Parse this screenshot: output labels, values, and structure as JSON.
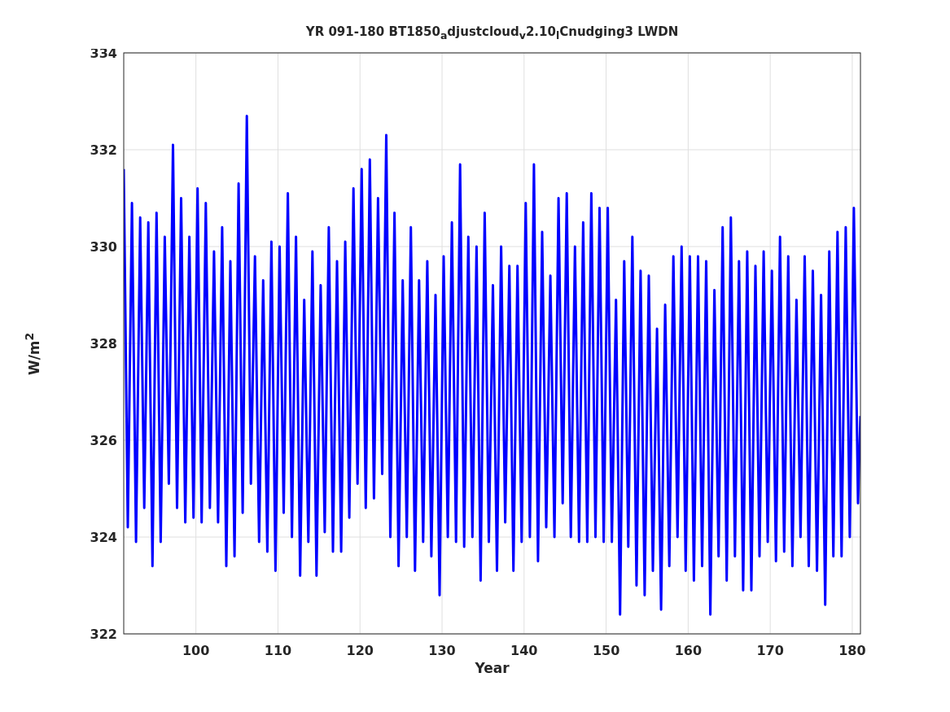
{
  "figure": {
    "chart_data": {
      "type": "line",
      "title": "YR 091-180 BT1850$_{a}$djustcloud$_{v}$2.10$_{l}$Cnudging3 LWDN",
      "xlabel": "Year",
      "ylabel": "W/m$^{2}$",
      "xlim": [
        91.2,
        181
      ],
      "ylim": [
        322,
        334
      ],
      "xticks": [
        100,
        110,
        120,
        130,
        140,
        150,
        160,
        170,
        180
      ],
      "yticks": [
        322,
        324,
        326,
        328,
        330,
        332,
        334
      ],
      "grid": true,
      "x": [
        91.2,
        91.7,
        92.2,
        92.7,
        93.2,
        93.7,
        94.2,
        94.7,
        95.2,
        95.7,
        96.2,
        96.7,
        97.2,
        97.7,
        98.2,
        98.7,
        99.2,
        99.7,
        100.2,
        100.7,
        101.2,
        101.7,
        102.2,
        102.7,
        103.2,
        103.7,
        104.2,
        104.7,
        105.2,
        105.7,
        106.2,
        106.7,
        107.2,
        107.7,
        108.2,
        108.7,
        109.2,
        109.7,
        110.2,
        110.7,
        111.2,
        111.7,
        112.2,
        112.7,
        113.2,
        113.7,
        114.2,
        114.7,
        115.2,
        115.7,
        116.2,
        116.7,
        117.2,
        117.7,
        118.2,
        118.7,
        119.2,
        119.7,
        120.2,
        120.7,
        121.2,
        121.7,
        122.2,
        122.7,
        123.2,
        123.7,
        124.2,
        124.7,
        125.2,
        125.7,
        126.2,
        126.7,
        127.2,
        127.7,
        128.2,
        128.7,
        129.2,
        129.7,
        130.2,
        130.7,
        131.2,
        131.7,
        132.2,
        132.7,
        133.2,
        133.7,
        134.2,
        134.7,
        135.2,
        135.7,
        136.2,
        136.7,
        137.2,
        137.7,
        138.2,
        138.7,
        139.2,
        139.7,
        140.2,
        140.7,
        141.2,
        141.7,
        142.2,
        142.7,
        143.2,
        143.7,
        144.2,
        144.7,
        145.2,
        145.7,
        146.2,
        146.7,
        147.2,
        147.7,
        148.2,
        148.7,
        149.2,
        149.7,
        150.2,
        150.7,
        151.2,
        151.7,
        152.2,
        152.7,
        153.2,
        153.7,
        154.2,
        154.7,
        155.2,
        155.7,
        156.2,
        156.7,
        157.2,
        157.7,
        158.2,
        158.7,
        159.2,
        159.7,
        160.2,
        160.7,
        161.2,
        161.7,
        162.2,
        162.7,
        163.2,
        163.7,
        164.2,
        164.7,
        165.2,
        165.7,
        166.2,
        166.7,
        167.2,
        167.7,
        168.2,
        168.7,
        169.2,
        169.7,
        170.2,
        170.7,
        171.2,
        171.7,
        172.2,
        172.7,
        173.2,
        173.7,
        174.2,
        174.7,
        175.2,
        175.7,
        176.2,
        176.7,
        177.2,
        177.7,
        178.2,
        178.7,
        179.2,
        179.7,
        180.2,
        180.7,
        181
      ],
      "series": [
        {
          "color": "#0000ff",
          "values": [
            331.6,
            324.2,
            330.9,
            323.9,
            330.6,
            324.6,
            330.5,
            323.4,
            330.7,
            323.9,
            330.2,
            325.1,
            332.1,
            324.6,
            331.0,
            324.3,
            330.2,
            324.4,
            331.2,
            324.3,
            330.9,
            324.6,
            329.9,
            324.3,
            330.4,
            323.4,
            329.7,
            323.6,
            331.3,
            324.5,
            332.7,
            325.1,
            329.8,
            323.9,
            329.3,
            323.7,
            330.1,
            323.3,
            330.0,
            324.5,
            331.1,
            324.0,
            330.2,
            323.2,
            328.9,
            323.9,
            329.9,
            323.2,
            329.2,
            324.1,
            330.4,
            323.7,
            329.7,
            323.7,
            330.1,
            324.4,
            331.2,
            325.1,
            331.6,
            324.6,
            331.8,
            324.8,
            331.0,
            325.3,
            332.3,
            324.0,
            330.7,
            323.4,
            329.3,
            324.0,
            330.4,
            323.3,
            329.3,
            323.9,
            329.7,
            323.6,
            329.0,
            322.8,
            329.8,
            324.0,
            330.5,
            323.9,
            331.7,
            323.8,
            330.2,
            324.0,
            330.0,
            323.1,
            330.7,
            323.9,
            329.2,
            323.3,
            330.0,
            324.3,
            329.6,
            323.3,
            329.6,
            323.9,
            330.9,
            324.0,
            331.7,
            323.5,
            330.3,
            324.2,
            329.4,
            324.0,
            331.0,
            324.7,
            331.1,
            324.0,
            330.0,
            323.9,
            330.5,
            323.9,
            331.1,
            324.0,
            330.8,
            323.9,
            330.8,
            323.9,
            328.9,
            322.4,
            329.7,
            323.8,
            330.2,
            323.0,
            329.5,
            322.8,
            329.4,
            323.3,
            328.3,
            322.5,
            328.8,
            323.4,
            329.8,
            324.0,
            330.0,
            323.3,
            329.8,
            323.1,
            329.8,
            323.4,
            329.7,
            322.4,
            329.1,
            323.6,
            330.4,
            323.1,
            330.6,
            323.6,
            329.7,
            322.9,
            329.9,
            322.9,
            329.6,
            323.6,
            329.9,
            323.9,
            329.5,
            323.5,
            330.2,
            323.7,
            329.8,
            323.4,
            328.9,
            324.0,
            329.8,
            323.4,
            329.5,
            323.3,
            329.0,
            322.6,
            329.9,
            323.6,
            330.3,
            323.6,
            330.4,
            324.0,
            330.8,
            324.7,
            326.5
          ]
        }
      ]
    }
  }
}
